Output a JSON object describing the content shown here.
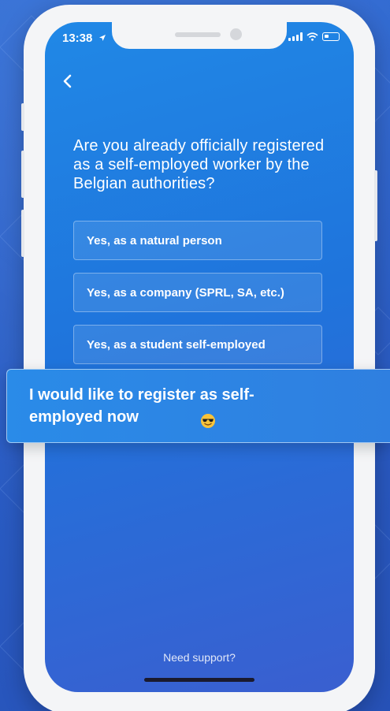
{
  "status_bar": {
    "time": "13:38",
    "location_icon": "location-arrow-icon"
  },
  "nav": {
    "back_icon": "chevron-left-icon"
  },
  "question": "Are you already officially registered as a self-employed worker by the Belgian authorities?",
  "options": [
    {
      "label": "Yes, as a natural person"
    },
    {
      "label": "Yes, as a company (SPRL, SA, etc.)"
    },
    {
      "label": "Yes, as a student self-employed"
    }
  ],
  "callout": {
    "text": "I would like to register as self-employed now",
    "emoji_icon": "sunglasses-emoji-icon"
  },
  "footer": {
    "support_link": "Need support?"
  },
  "colors": {
    "background": "#2f63c8",
    "screen_top": "#2088e6",
    "screen_bottom": "#3a5fd0",
    "phone_frame": "#f4f5f7"
  }
}
